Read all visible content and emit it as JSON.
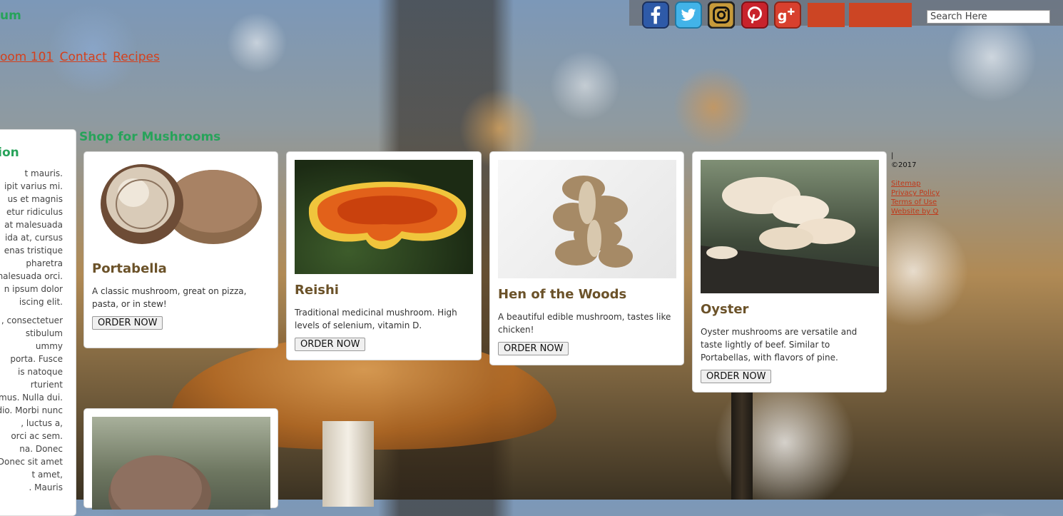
{
  "header": {
    "brand": "um",
    "nav": [
      "oom 101",
      "Contact",
      "Recipes"
    ],
    "search_placeholder": "Search Here"
  },
  "social": [
    "facebook-icon",
    "twitter-icon",
    "instagram-icon",
    "pinterest-icon",
    "google-plus-icon"
  ],
  "colors": {
    "accent_green": "#27a35a",
    "link_red": "#d4401c",
    "button_orange": "#cc4524",
    "title_brown": "#6b5229"
  },
  "sidebar": {
    "heading": "tion",
    "paragraph1": [
      "t mauris.",
      "ipit varius mi.",
      "us et magnis",
      "etur ridiculus",
      "at malesuada",
      "ida at, cursus",
      "enas tristique",
      "pharetra",
      "nalesuada orci.",
      "n ipsum dolor",
      "iscing elit."
    ],
    "paragraph2": [
      ", consectetuer",
      "stibulum",
      "ummy",
      "porta. Fusce",
      "is natoque",
      "rturient",
      "mus. Nulla dui.",
      "dio. Morbi nunc",
      ", luctus a,",
      "orci ac sem.",
      "na. Donec",
      "Donec sit amet",
      "t amet,",
      ". Mauris"
    ]
  },
  "shop": {
    "title": "Shop for Mushrooms",
    "order_label": "ORDER NOW",
    "products": [
      {
        "name": "Portabella",
        "desc": "A classic mushroom, great on pizza, pasta, or in stew!"
      },
      {
        "name": "Reishi",
        "desc": "Traditional medicinal mushroom. High levels of selenium, vitamin D."
      },
      {
        "name": "Hen of the Woods",
        "desc": "A beautiful edible mushroom, tastes like chicken!"
      },
      {
        "name": "Oyster",
        "desc": "Oyster mushrooms are versatile and taste lightly of beef. Similar to Portabellas, with flavors of pine."
      }
    ]
  },
  "footer": {
    "bar": "|",
    "copyright": "©2017",
    "links": [
      "Sitemap",
      "Privacy Policy",
      "Terms of Use",
      "Website by Q"
    ]
  }
}
